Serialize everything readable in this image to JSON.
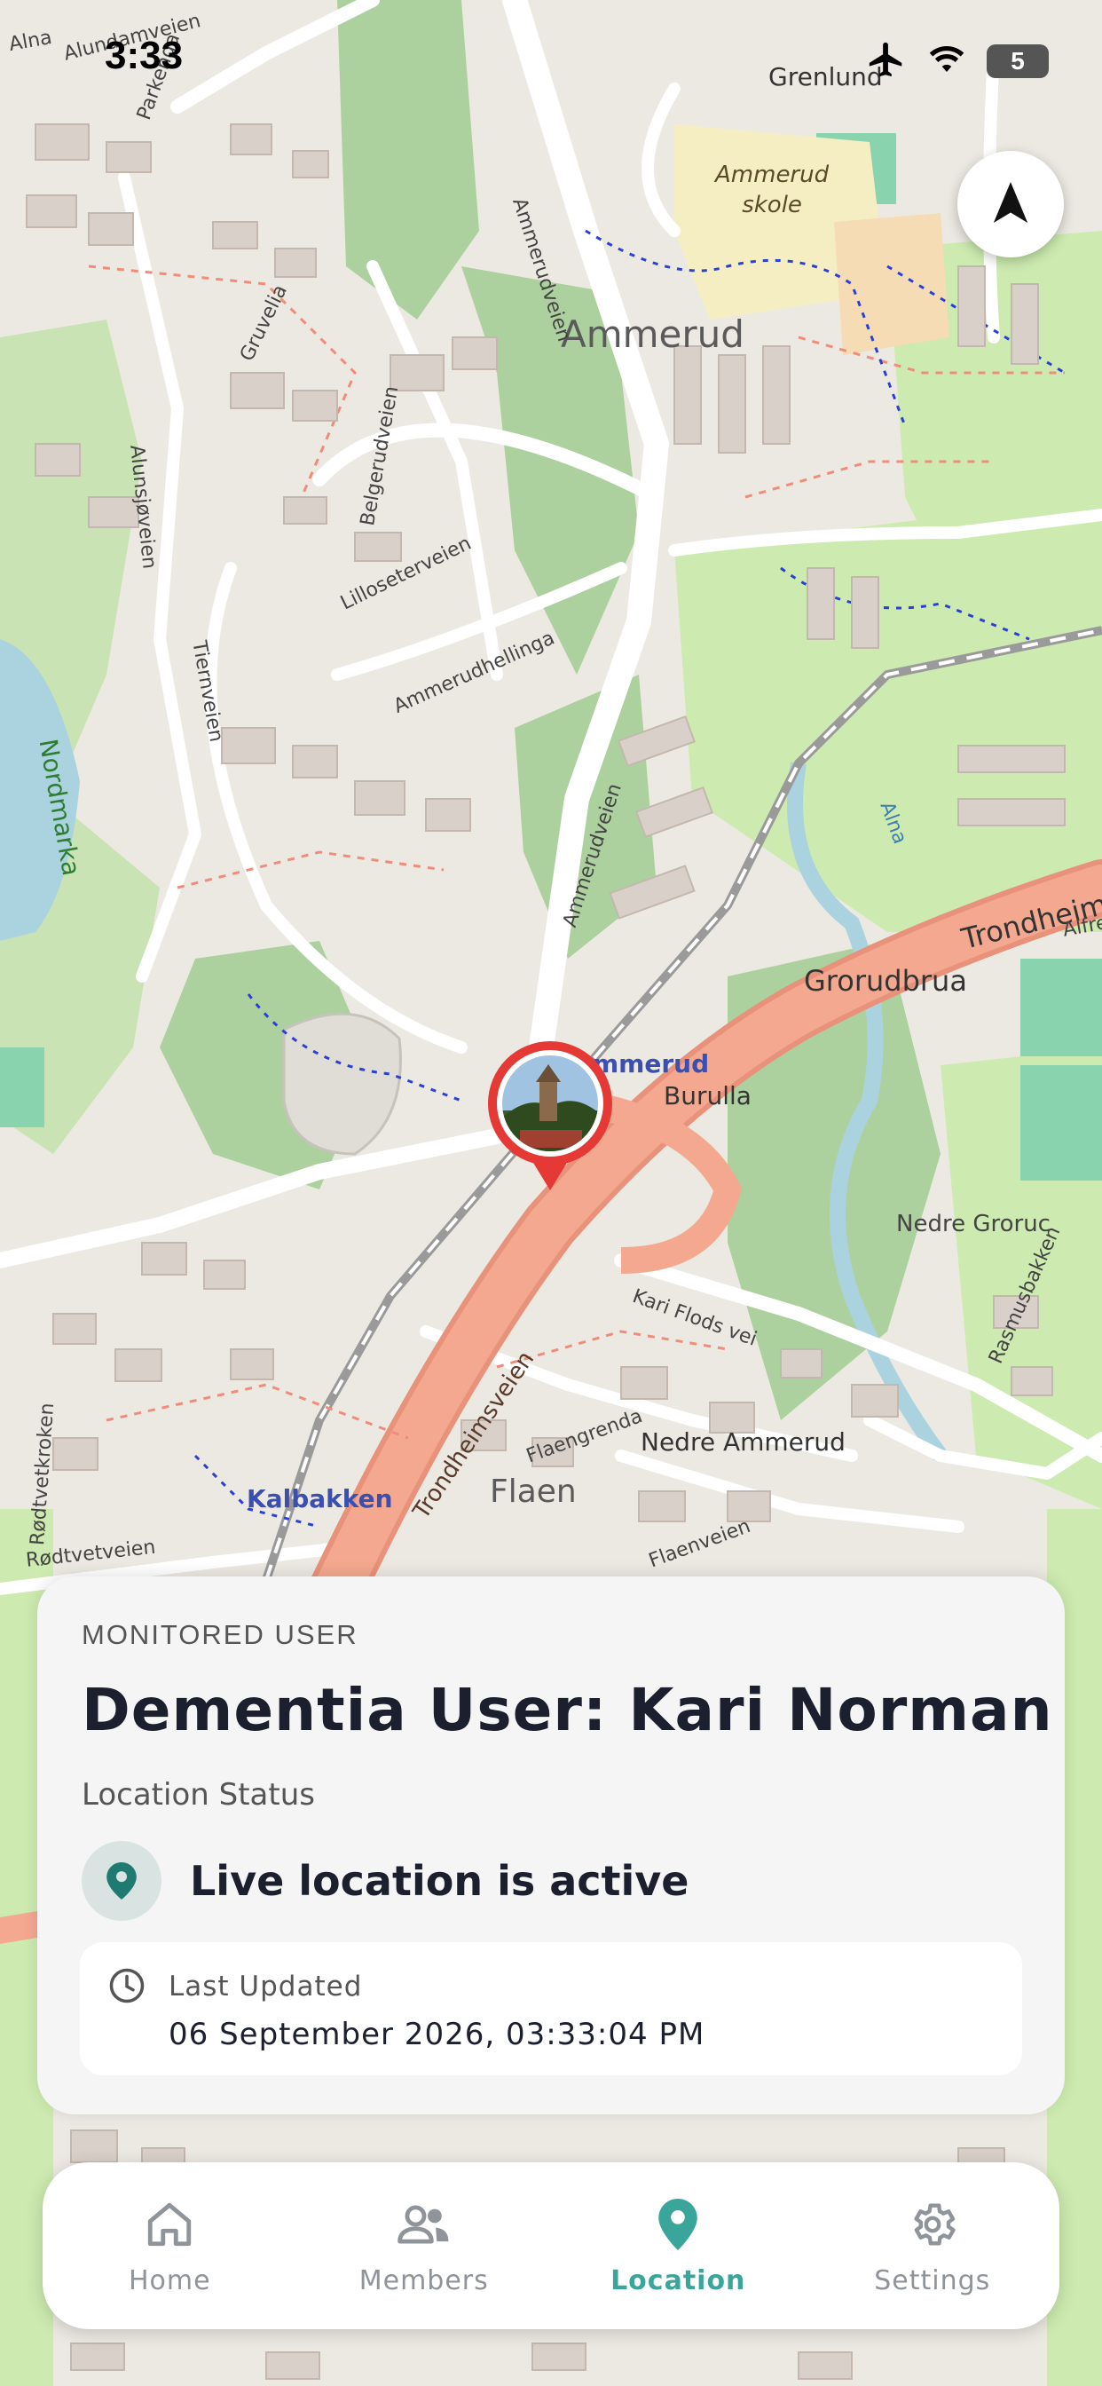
{
  "status_bar": {
    "time": "3:33",
    "battery": "5",
    "icons": [
      "airplane-icon",
      "wifi-icon",
      "battery-icon"
    ]
  },
  "map": {
    "labels": {
      "ammerud": "Ammerud",
      "grorudbrua": "Grorudbrua",
      "burulla": "Burulla",
      "flaen": "Flaen",
      "nedre_ammerud": "Nedre Ammerud",
      "kalbakken": "Kalbakken",
      "grenlund": "Grenlund",
      "ammerud_skole": "Ammerud skole",
      "nordmarka": "Nordmarka",
      "alna": "Alna",
      "nedre_grorud": "Nedre Groruc",
      "trondheimsveien": "Trondheimsveien",
      "trondheims_right": "Trondheims",
      "ammerudveien_top": "Ammerudveien",
      "ammerudveien_mid": "Ammerudveien",
      "ammerudhellinga": "Ammerudhellinga",
      "lilloseterveien": "Lilloseterveien",
      "belgerudveien": "Belgerudveien",
      "gruvelia": "Gruvelia",
      "parkenga": "Parkenga",
      "alunsjoveien": "Alunsjøveien",
      "tiernveien": "Tiernveien",
      "kari_flods_vei": "Kari Flods vei",
      "flaengrenda": "Flaengrenda",
      "flaenveien": "Flaenveien",
      "rasmusbakken": "Rasmusbakken",
      "rodtvetveien": "Rødtvetveien",
      "rodtvetkroken": "Rødtvetkroken",
      "ammerud_station": "mmerud",
      "alna_top": "Alna",
      "alundamveien": "Alundamveien",
      "alfre": "Alfre"
    }
  },
  "compass": {
    "icon": "navigation-arrow-icon"
  },
  "marker": {
    "icon": "user-photo-avatar"
  },
  "card": {
    "kicker": "MONITORED USER",
    "title": "Dementia User: Kari Norman",
    "subtitle": "Location Status",
    "status_text": "Live location is active",
    "status_icon": "location-pin-icon",
    "accent_color": "#1f7a72",
    "updated_label": "Last Updated",
    "updated_value": "06 September 2026, 03:33:04 PM"
  },
  "nav": {
    "active_color": "#3aa59b",
    "inactive_color": "#8f949b",
    "items": [
      {
        "label": "Home",
        "icon": "home-icon",
        "active": false
      },
      {
        "label": "Members",
        "icon": "members-icon",
        "active": false
      },
      {
        "label": "Location",
        "icon": "location-pin-icon",
        "active": true
      },
      {
        "label": "Settings",
        "icon": "gear-icon",
        "active": false
      }
    ]
  }
}
